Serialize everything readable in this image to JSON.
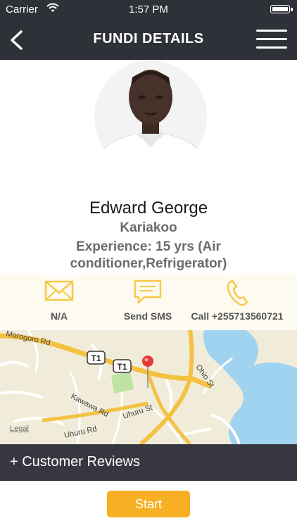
{
  "status_bar": {
    "carrier": "Carrier",
    "time": "1:57 PM"
  },
  "header": {
    "title": "FUNDI DETAILS"
  },
  "profile": {
    "name": "Edward George",
    "location": "Kariakoo",
    "experience": "Experience: 15 yrs (Air conditioner,Refrigerator)"
  },
  "contact": {
    "email_label": "N/A",
    "sms_label": "Send SMS",
    "call_label": "Call +255713560721",
    "icon_color": "#f7c948"
  },
  "map": {
    "roads": [
      "Morogoro Rd",
      "Kawawa Rd",
      "Uhuru Rd",
      "Uhuru St",
      "Ohio St"
    ],
    "badges": [
      "T1",
      "T1"
    ],
    "legal": "Legal"
  },
  "reviews": {
    "label": "+ Customer Reviews"
  },
  "actions": {
    "start_label": "Start"
  },
  "colors": {
    "header_bg": "#2f3138",
    "accent": "#f7b023",
    "pin": "#e53935"
  }
}
